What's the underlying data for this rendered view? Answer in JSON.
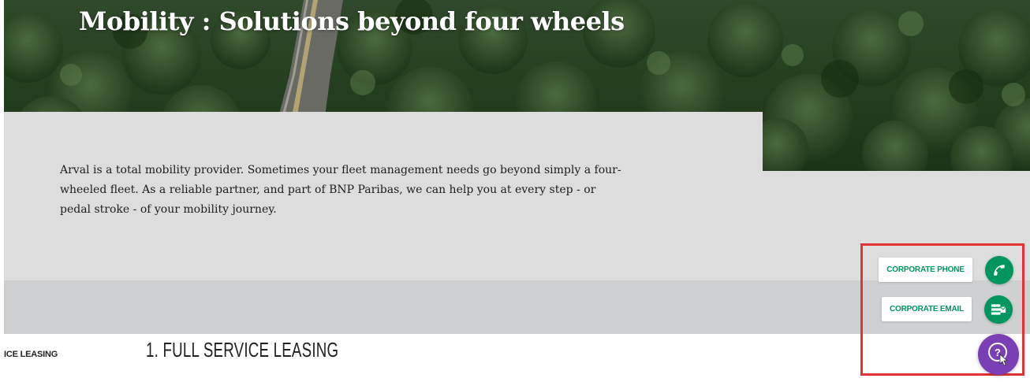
{
  "hero": {
    "title": "Mobility : Solutions beyond four wheels"
  },
  "intro": {
    "text": "Arval is a total mobility provider. Sometimes your fleet management needs go beyond simply a four-wheeled fleet. As a reliable partner, and part of BNP Paribas, we can help you at every step - or pedal stroke - of your mobility journey."
  },
  "section": {
    "tab_label_truncated": "ICE LEASING",
    "heading": "1. FULL SERVICE LEASING"
  },
  "contact": {
    "phone_label": "CORPORATE PHONE",
    "email_label": "CORPORATE EMAIL",
    "phone_icon": "phone-icon",
    "email_icon": "contact-card-icon",
    "help_icon": "help-question-icon"
  },
  "colors": {
    "brand_green": "#00965e",
    "help_purple": "#7a3fb5",
    "highlight_red": "#e53333"
  }
}
